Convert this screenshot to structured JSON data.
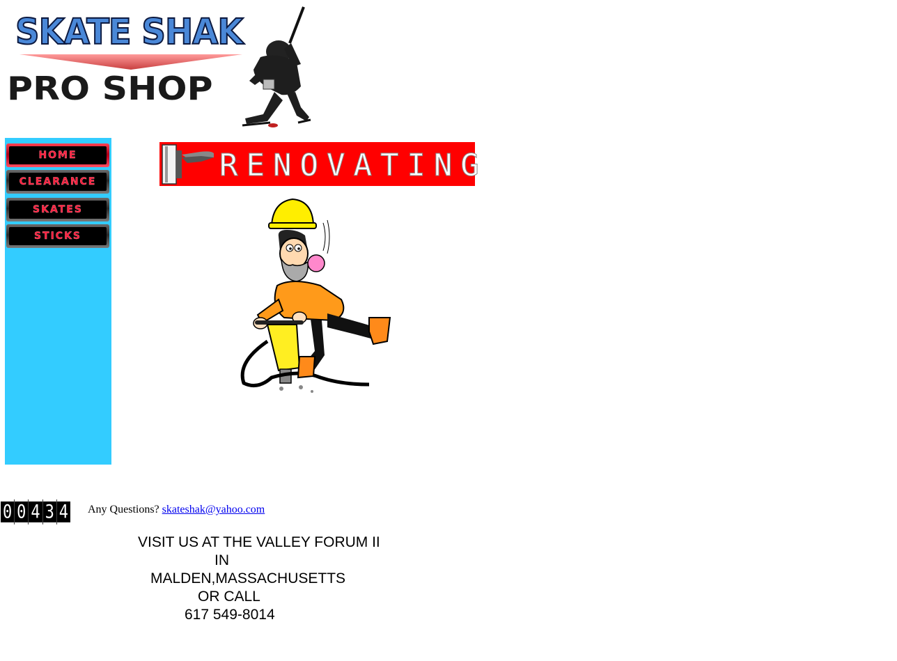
{
  "logo": {
    "line1": "SKATE SHAK",
    "line2": "PRO SHOP",
    "icon": "hockey-player-icon"
  },
  "nav": {
    "items": [
      {
        "label": "HOME"
      },
      {
        "label": "CLEARANCE"
      },
      {
        "label": "SKATES"
      },
      {
        "label": "STICKS"
      }
    ]
  },
  "banner": {
    "text": "RENOVATING",
    "icon": "paintbrush-icon"
  },
  "illustration": {
    "icon": "jackhammer-worker-icon"
  },
  "counter": {
    "digits": [
      "0",
      "0",
      "4",
      "3",
      "4"
    ]
  },
  "contact": {
    "prompt": "Any Questions?",
    "email": "skateshak@yahoo.com"
  },
  "visit": {
    "line1": "VISIT US AT THE VALLEY FORUM II",
    "line2": "IN",
    "line3": "MALDEN,MASSACHUSETTS",
    "line4": "OR CALL",
    "line5": "617 549-8014"
  },
  "colors": {
    "sidebar": "#33ccff",
    "banner": "#ff0000",
    "nav_text": "#ff1a3a",
    "link": "#0000ee"
  }
}
